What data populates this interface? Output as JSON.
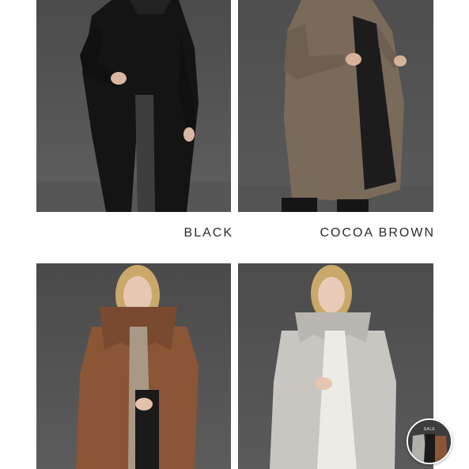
{
  "products": [
    {
      "color_name": "BLACK",
      "coat_color": "#1a1a1a"
    },
    {
      "color_name": "COCOA BROWN",
      "coat_color": "#7a6a5a"
    },
    {
      "color_name": "",
      "coat_color": "#8a5636"
    },
    {
      "color_name": "",
      "coat_color": "#c9c6c2"
    }
  ],
  "badge": {
    "label": "SALE"
  },
  "colors": {
    "page_background": "#ffffff",
    "photo_background": "#5c5c5c",
    "caption_text": "#2b2b2b"
  }
}
